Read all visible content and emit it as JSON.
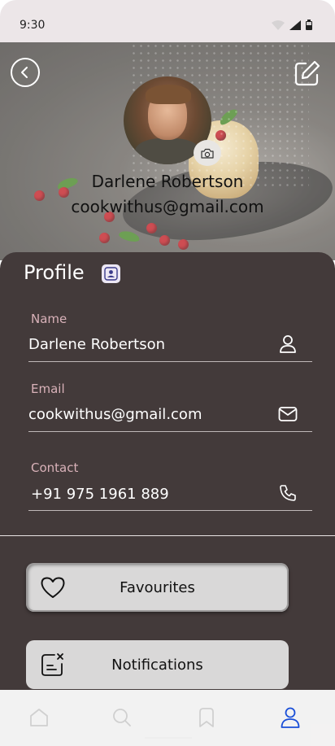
{
  "status_bar": {
    "time": "9:30"
  },
  "header": {
    "name": "Darlene Robertson",
    "email": "cookwithus@gmail.com"
  },
  "profile": {
    "title": "Profile",
    "fields": [
      {
        "label": "Name",
        "value": "Darlene Robertson",
        "icon": "user-icon"
      },
      {
        "label": "Email",
        "value": "cookwithus@gmail.com",
        "icon": "mail-icon"
      },
      {
        "label": "Contact",
        "value": "+91 975 1961 889",
        "icon": "phone-icon"
      }
    ]
  },
  "menu": {
    "favourites_label": "Favourites",
    "notifications_label": "Notifications"
  },
  "bottom_nav": {
    "items": [
      "home-icon",
      "search-icon",
      "bookmark-icon",
      "profile-icon"
    ],
    "active": "profile-icon",
    "active_color": "#1a4fd8",
    "inactive_color": "#d0d0d0"
  },
  "colors": {
    "panel": "#433a3a",
    "label": "#d9b2b9",
    "button": "#d9d8d8"
  }
}
